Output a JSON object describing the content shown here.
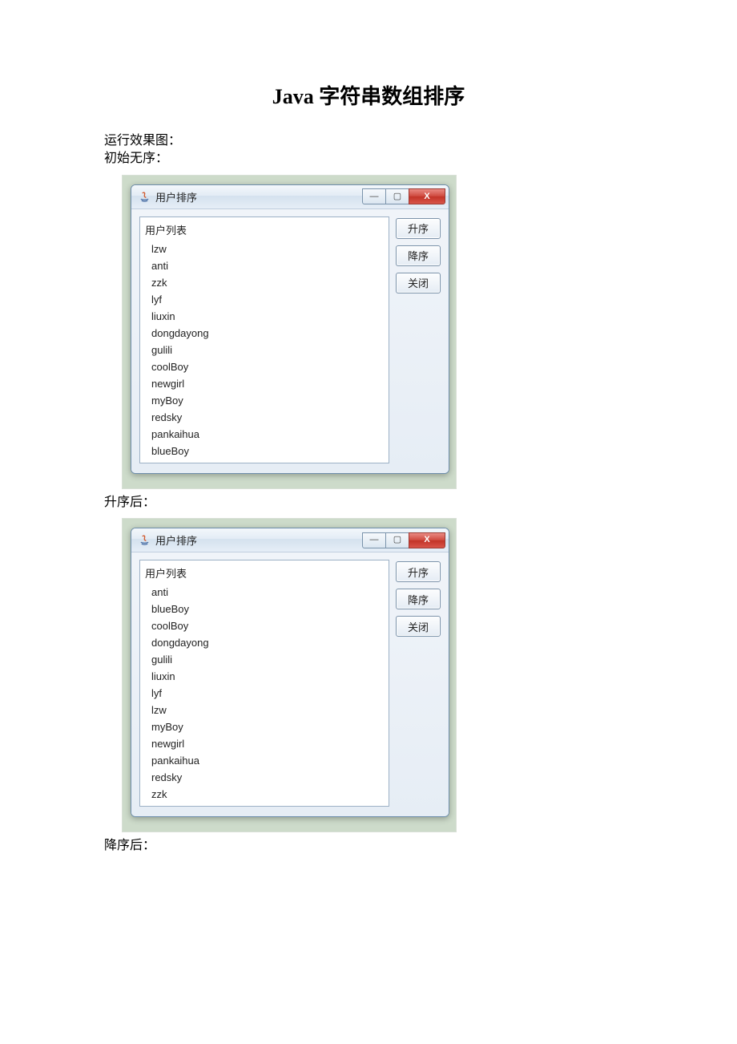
{
  "document": {
    "title": "Java 字符串数组排序",
    "caption_run": "运行效果图：",
    "caption_initial": "初始无序：",
    "caption_asc": "升序后：",
    "caption_desc": "降序后："
  },
  "window": {
    "title": "用户排序",
    "list_header": "用户列表",
    "buttons": {
      "asc": "升序",
      "desc": "降序",
      "close": "关闭"
    },
    "controls": {
      "minimize": "—",
      "maximize": "▢",
      "close": "X"
    }
  },
  "lists": {
    "unsorted": [
      "lzw",
      "anti",
      "zzk",
      "lyf",
      "liuxin",
      "dongdayong",
      "gulili",
      "coolBoy",
      "newgirl",
      "myBoy",
      "redsky",
      "pankaihua",
      "blueBoy"
    ],
    "ascending": [
      "anti",
      "blueBoy",
      "coolBoy",
      "dongdayong",
      "gulili",
      "liuxin",
      "lyf",
      "lzw",
      "myBoy",
      "newgirl",
      "pankaihua",
      "redsky",
      "zzk"
    ]
  }
}
